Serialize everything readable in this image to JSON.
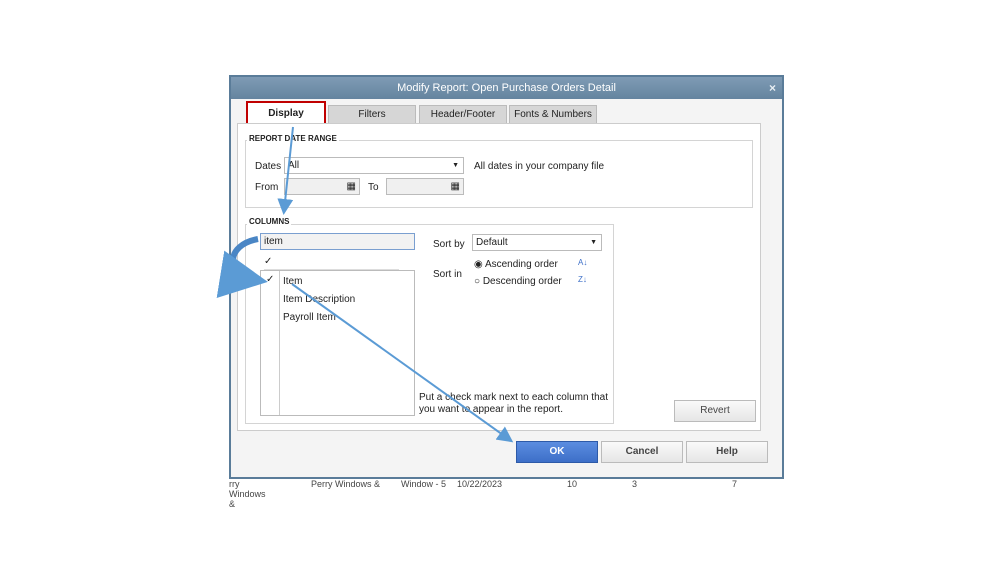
{
  "dialog": {
    "title": "Modify Report: Open Purchase Orders Detail",
    "close": "×"
  },
  "tabs": [
    {
      "label": "Display",
      "active": true
    },
    {
      "label": "Filters"
    },
    {
      "label": "Header/Footer"
    },
    {
      "label": "Fonts & Numbers"
    }
  ],
  "date_range": {
    "section": "REPORT DATE RANGE",
    "dates_label": "Dates",
    "dates_value": "All",
    "dates_note": "All dates in your company file",
    "from_label": "From",
    "from_value": "",
    "to_label": "To",
    "to_value": ""
  },
  "columns": {
    "section": "COLUMNS",
    "search_value": "item",
    "list": [
      {
        "label": "Item",
        "checked": true
      },
      {
        "label": "Item Description",
        "checked": false
      },
      {
        "label": "Payroll Item",
        "checked": false
      }
    ],
    "header_check": "✓",
    "hint": "Put a check mark next to each column that you want to appear in the report."
  },
  "sort": {
    "sort_by_label": "Sort by",
    "sort_by_value": "Default",
    "sort_in_label": "Sort in",
    "ascending": "Ascending order",
    "descending": "Descending order",
    "selected": "ascending"
  },
  "buttons": {
    "revert": "Revert",
    "ok": "OK",
    "cancel": "Cancel",
    "help": "Help"
  },
  "background_row": [
    "rry Windows &",
    "Perry Windows &",
    "Window - 5",
    "10/22/2023",
    "10",
    "3",
    "7"
  ],
  "colors": {
    "accent": "#3d6fc8",
    "highlight": "#c00000",
    "annotation": "#5b9bd5"
  }
}
